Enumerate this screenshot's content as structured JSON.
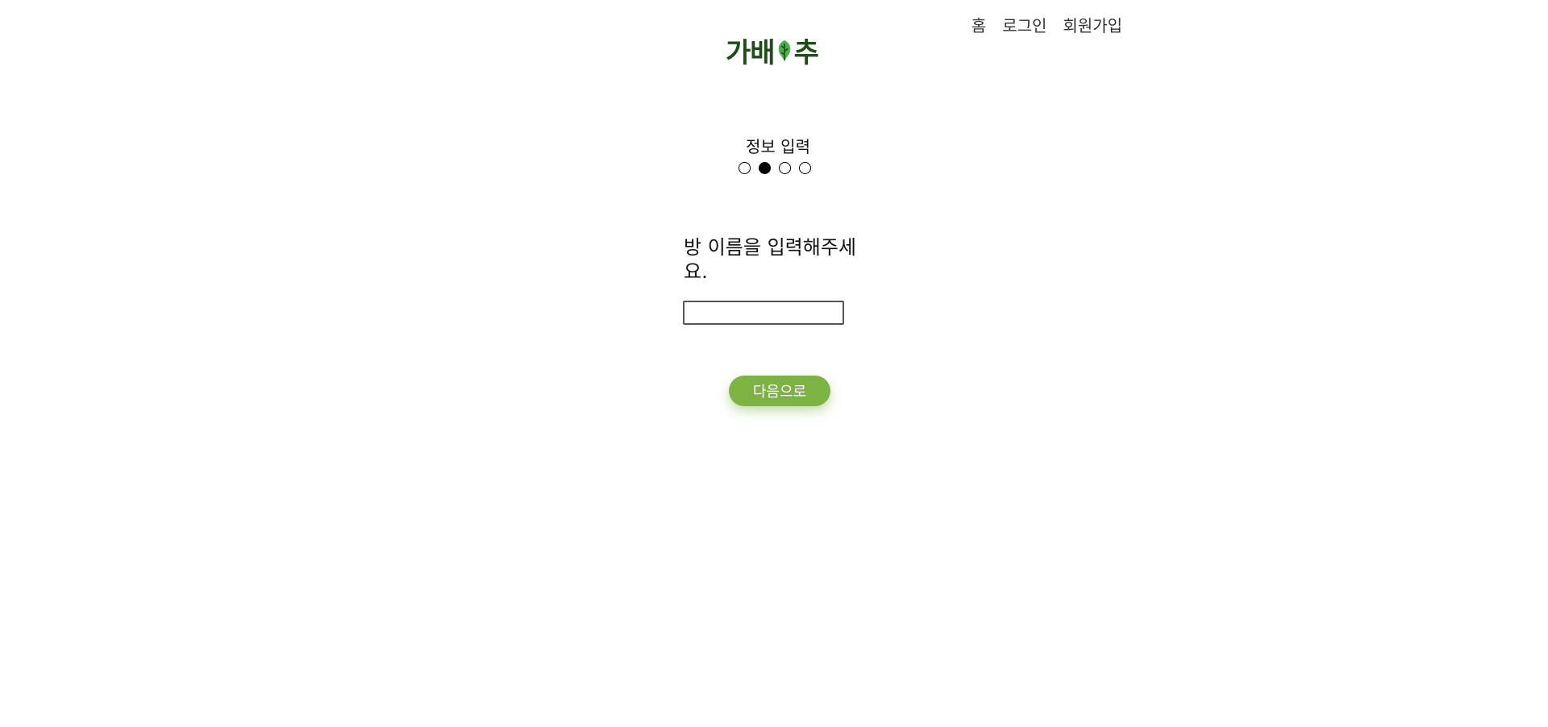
{
  "nav": {
    "home": "홈",
    "login": "로그인",
    "signup": "회원가입"
  },
  "logo": {
    "text_left": "가배",
    "text_right": "추",
    "icon": "cabbage-leaf-icon"
  },
  "step": {
    "title": "정보 입력",
    "total": 4,
    "current": 2
  },
  "form": {
    "question": "방 이름을 입력해주세요.",
    "room_name_value": "",
    "next_label": "다음으로"
  },
  "colors": {
    "accent": "#7cb342",
    "logo": "#1e4d17",
    "logo_leaf": "#4caf50"
  }
}
